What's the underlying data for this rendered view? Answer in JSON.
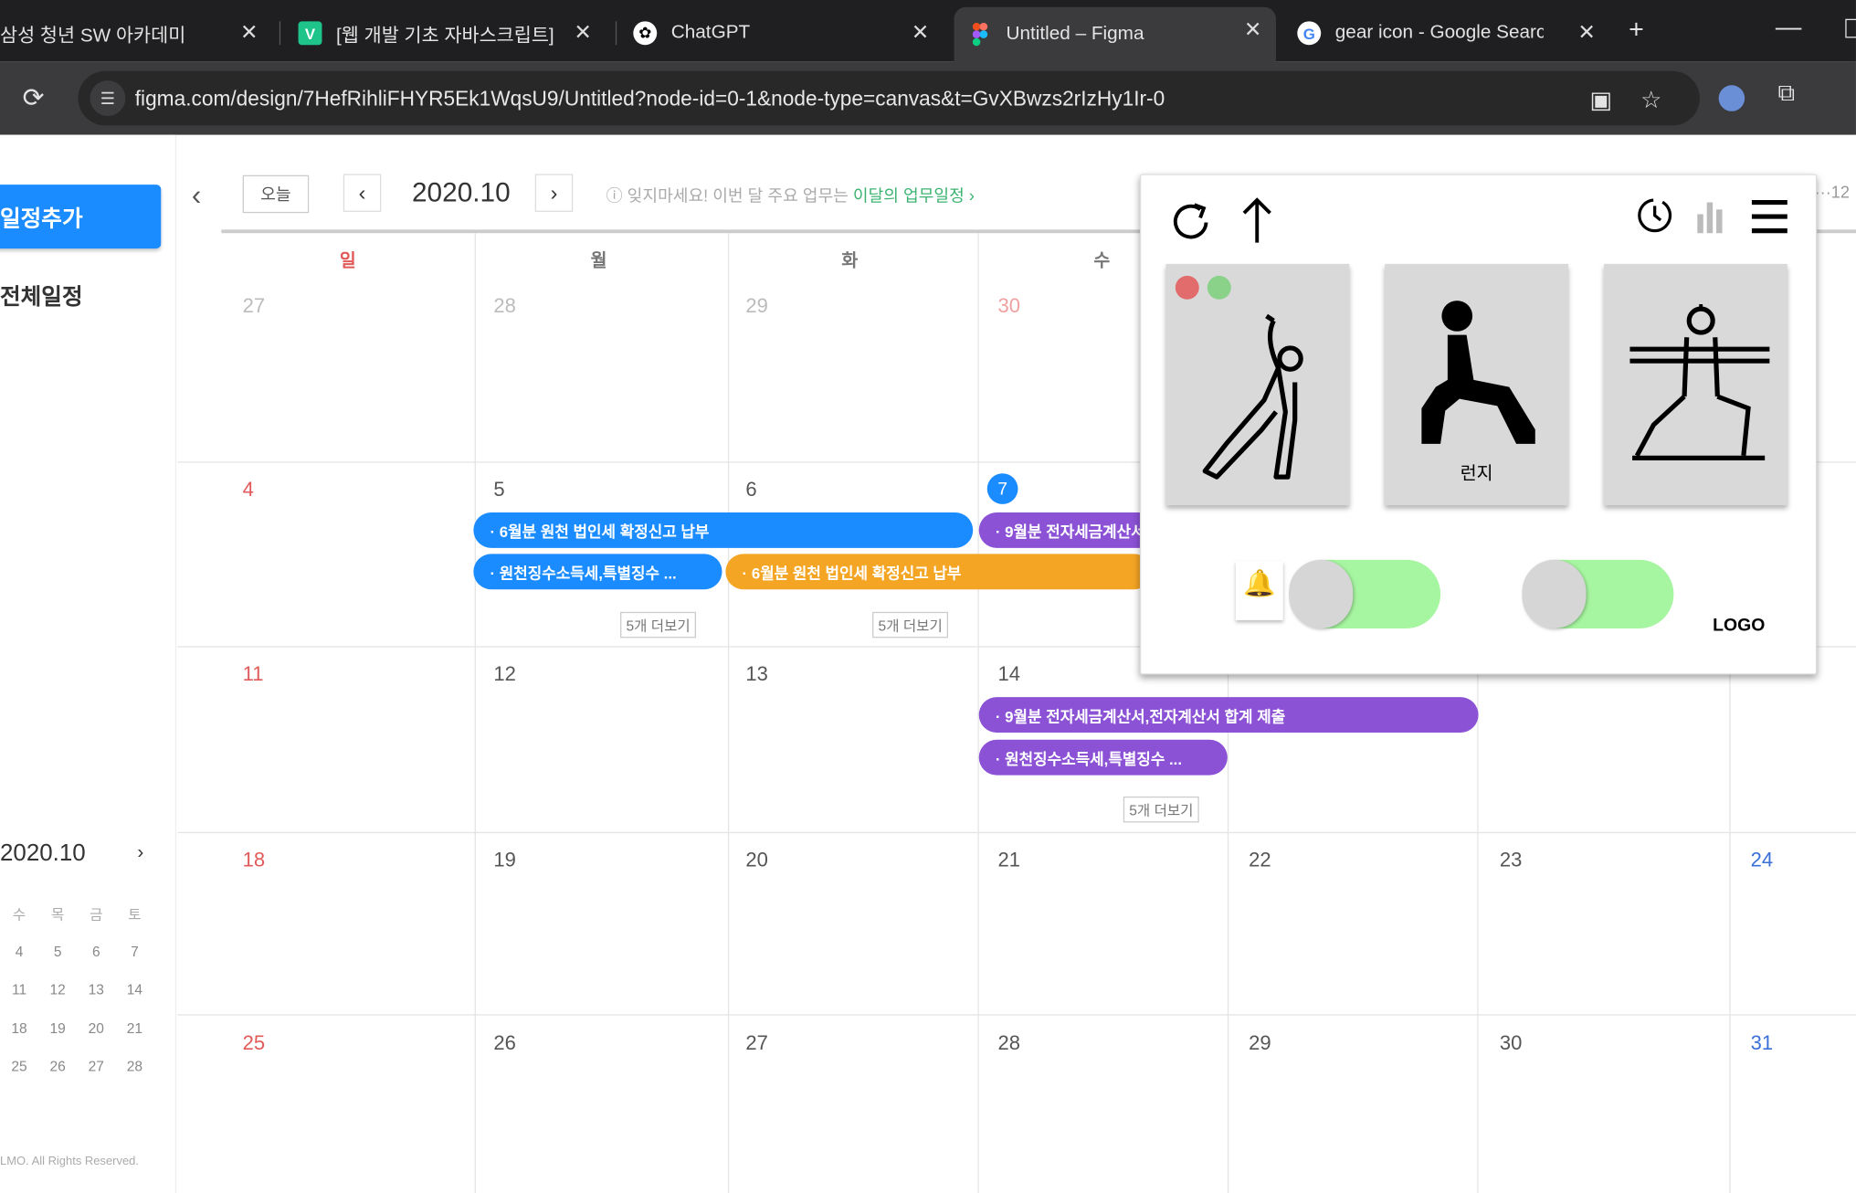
{
  "browser": {
    "tabs": [
      {
        "title": "삼성 청년 SW 아카데미",
        "favicon": "samsung-icon",
        "active": false
      },
      {
        "title": "[웹 개발 기초 자바스크립트]",
        "favicon": "v-icon",
        "active": false
      },
      {
        "title": "ChatGPT",
        "favicon": "chatgpt-icon",
        "active": false
      },
      {
        "title": "Untitled – Figma",
        "favicon": "figma-icon",
        "active": true
      },
      {
        "title": "gear icon - Google Search",
        "favicon": "google-icon",
        "active": false
      }
    ],
    "new_tab": "+",
    "url": "figma.com/design/7HefRihliFHYR5Ek1WqsU9/Untitled?node-id=0-1&node-type=canvas&t=GvXBwzs2rIzHy1Ir-0",
    "close_glyph": "✕"
  },
  "sidebar": {
    "add_button": "일정추가",
    "all_schedule": "전체일정",
    "mini_month": "2020.10",
    "mini_next": "›",
    "mini_rows": [
      [
        "수",
        "목",
        "금",
        "토"
      ],
      [
        "4",
        "5",
        "6",
        "7"
      ],
      [
        "11",
        "12",
        "13",
        "14"
      ],
      [
        "18",
        "19",
        "20",
        "21"
      ],
      [
        "25",
        "26",
        "27",
        "28"
      ]
    ],
    "copyright": "LMO. All Rights Reserved."
  },
  "calendar": {
    "collapse": "‹",
    "today_btn": "오늘",
    "prev": "‹",
    "month": "2020.10",
    "next": "›",
    "notice_prefix": "ⓘ 잊지마세요! 이번 달 주요 업무는",
    "notice_link": "이달의 업무일정 ›",
    "weekdays": [
      "일",
      "월",
      "화",
      "수"
    ],
    "weeks": [
      [
        "27",
        "28",
        "29",
        "30"
      ],
      [
        "4",
        "5",
        "6",
        "7"
      ],
      [
        "11",
        "12",
        "13",
        "14"
      ],
      [
        "18",
        "19",
        "20",
        "21",
        "22",
        "23",
        "24"
      ],
      [
        "25",
        "26",
        "27",
        "28",
        "29",
        "30",
        "31"
      ]
    ],
    "events": [
      {
        "label": "· 6월분 원천 법인세 확정신고 납부",
        "color": "blue"
      },
      {
        "label": "· 9월분 전자세금계산서",
        "color": "purple"
      },
      {
        "label": "· 원천징수소득세,특별징수 ...",
        "color": "blue"
      },
      {
        "label": "· 6월분 원천 법인세 확정신고 납부",
        "color": "orange"
      },
      {
        "label": "· 9월분 전자세금계산서,전자계산서 합계 제출",
        "color": "purple"
      },
      {
        "label": "· 원천징수소득세,특별징수 ...",
        "color": "purple"
      }
    ],
    "more_label": "5개 더보기",
    "colors": {
      "blue": "#1a8cff",
      "purple": "#8c52d6",
      "orange": "#f5a524"
    }
  },
  "widget": {
    "toolbar_left": [
      "refresh-icon",
      "arrow-up-icon"
    ],
    "toolbar_right": [
      "clock-icon",
      "bar-chart-icon",
      "hamburger-menu-icon"
    ],
    "cards": [
      {
        "icon": "side-stretch-pose-icon",
        "label": ""
      },
      {
        "icon": "lunge-pose-icon",
        "label": "런지"
      },
      {
        "icon": "warrior-pose-icon",
        "label": ""
      }
    ],
    "status_dots": [
      "#e26b6b",
      "#8ad18a"
    ],
    "bell": "🔔",
    "toggles": [
      true,
      true
    ],
    "logo": "LOGO"
  }
}
